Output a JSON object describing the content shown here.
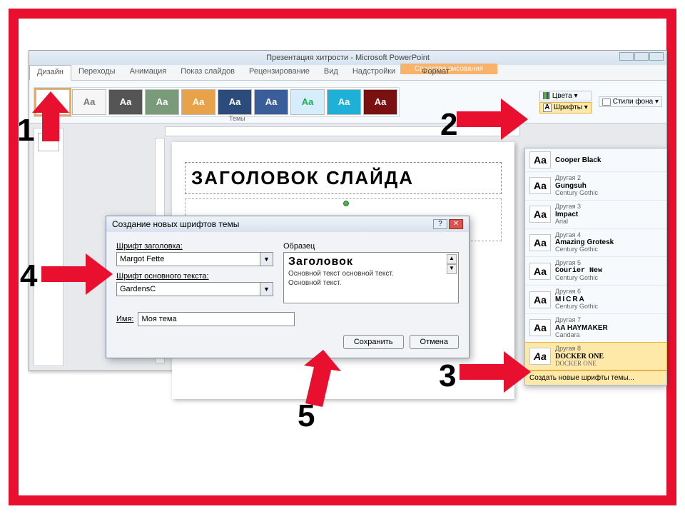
{
  "window": {
    "title": "Презентация хитрости - Microsoft PowerPoint"
  },
  "drawing_tools": {
    "group": "Средства рисования",
    "tab": "Формат"
  },
  "tabs": {
    "design": "Дизайн",
    "transitions": "Переходы",
    "animation": "Анимация",
    "slideshow": "Показ слайдов",
    "review": "Рецензирование",
    "view": "Вид",
    "addins": "Надстройки"
  },
  "ribbon": {
    "themes_label": "Темы",
    "aa1": "Aa",
    "aa2": "Aa",
    "aa3": "Aa",
    "aa4": "Aa",
    "aa5": "Aa",
    "aa6": "Aa",
    "aa7": "Aa",
    "aa8": "Aa",
    "aa9": "Aa",
    "aa10": "Aa",
    "colors": "Цвета ▾",
    "fonts": "Шрифты ▾",
    "bgstyles": "Стили фона ▾"
  },
  "slide": {
    "title": "ЗАГОЛОВОК СЛАЙДА"
  },
  "flyout": {
    "items": [
      {
        "group": "",
        "name": "Cooper Black",
        "sub": ""
      },
      {
        "group": "Другая 2",
        "name": "Gungsuh",
        "sub": "Century Gothic"
      },
      {
        "group": "Другая 3",
        "name": "Impact",
        "sub": "Arial"
      },
      {
        "group": "Другая 4",
        "name": "Amazing Grotesk",
        "sub": "Century Gothic"
      },
      {
        "group": "Другая 5",
        "name": "Courier New",
        "sub": "Century Gothic"
      },
      {
        "group": "Другая 6",
        "name": "MICRA",
        "sub": "Century Gothic"
      },
      {
        "group": "Другая 7",
        "name": "AA HAYMAKER",
        "sub": "Candara"
      },
      {
        "group": "Другая 8",
        "name": "DOCKER ONE",
        "sub": "DOCKER ONE"
      }
    ],
    "create": "Создать новые шрифты темы..."
  },
  "dialog": {
    "title": "Создание новых шрифтов темы",
    "heading_font_label": "Шрифт заголовка:",
    "heading_font_value": "Margot Fette",
    "body_font_label": "Шрифт основного текста:",
    "body_font_value": "GardensC",
    "sample_label": "Образец",
    "sample_title": "Заголовок",
    "sample_body1": "Основной текст основной текст.",
    "sample_body2": "Основной текст.",
    "name_label": "Имя:",
    "name_value": "Моя тема",
    "save": "Сохранить",
    "cancel": "Отмена",
    "help": "?",
    "close": "✕"
  },
  "annotations": {
    "n1": "1",
    "n2": "2",
    "n3": "3",
    "n4": "4",
    "n5": "5"
  }
}
